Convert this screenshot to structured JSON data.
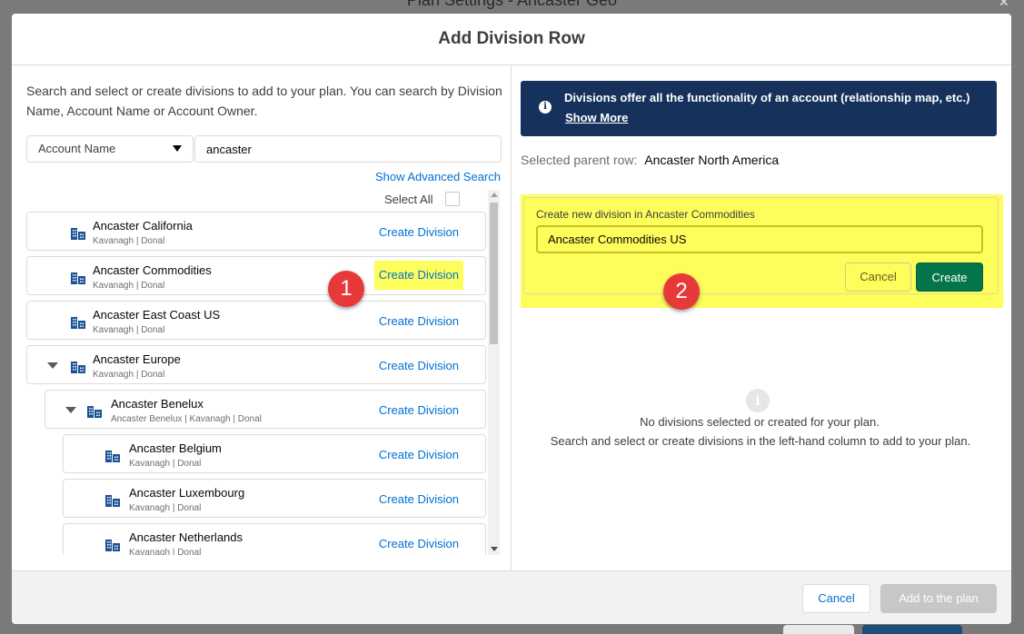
{
  "backdrop": {
    "title": "Plan Settings - Ancaster Geo"
  },
  "modal": {
    "title": "Add Division Row"
  },
  "left": {
    "intro": "Search and select or create divisions to add to your plan. You can search by Division Name, Account Name or Account Owner.",
    "search": {
      "field_label": "Account Name",
      "query": "ancaster",
      "placeholder": ""
    },
    "advanced_search_link": "Show Advanced Search",
    "select_all_label": "Select All",
    "rows": [
      {
        "name": "Ancaster California",
        "sub": "Kavanagh | Donal",
        "action": "Create Division"
      },
      {
        "name": "Ancaster Commodities",
        "sub": "Kavanagh | Donal",
        "action": "Create Division"
      },
      {
        "name": "Ancaster East Coast US",
        "sub": "Kavanagh | Donal",
        "action": "Create Division"
      },
      {
        "name": "Ancaster Europe",
        "sub": "Kavanagh | Donal",
        "action": "Create Division"
      },
      {
        "name": "Ancaster Benelux",
        "sub": "Ancaster Benelux | Kavanagh | Donal",
        "action": "Create Division"
      },
      {
        "name": "Ancaster Belgium",
        "sub": "Kavanagh | Donal",
        "action": "Create Division"
      },
      {
        "name": "Ancaster Luxembourg",
        "sub": "Kavanagh | Donal",
        "action": "Create Division"
      },
      {
        "name": "Ancaster Netherlands",
        "sub": "Kavanagh | Donal",
        "action": "Create Division"
      }
    ]
  },
  "badges": {
    "one": "1",
    "two": "2"
  },
  "right": {
    "banner": {
      "text": "Divisions offer all the functionality of an account (relationship map, etc.)",
      "link": "Show More"
    },
    "parent": {
      "label": "Selected parent row:",
      "value": "Ancaster North America"
    },
    "create_form": {
      "label": "Create new division in Ancaster Commodities",
      "value": "Ancaster Commodities US",
      "cancel": "Cancel",
      "create": "Create"
    },
    "empty": {
      "title": "No divisions selected or created for your plan.",
      "desc": "Search and select or create divisions in the left-hand column to add to your plan."
    }
  },
  "footer": {
    "cancel": "Cancel",
    "add": "Add to the plan"
  },
  "colors": {
    "brand_dark": "#16325c",
    "link": "#0070d2",
    "success": "#04754b",
    "highlight": "#fdfd5c",
    "badge": "#e8393a"
  }
}
